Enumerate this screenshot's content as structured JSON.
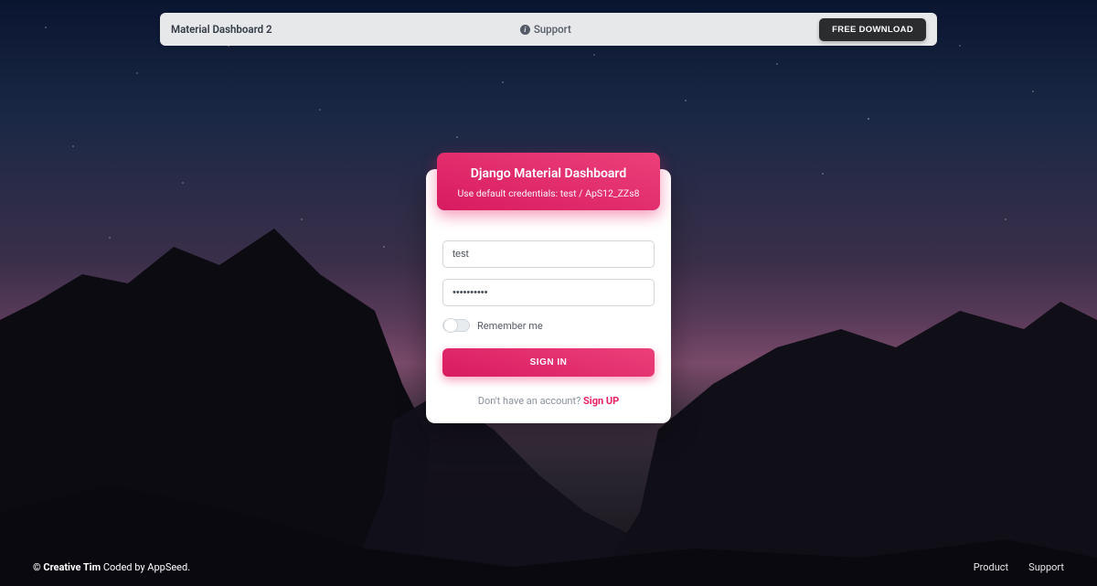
{
  "nav": {
    "brand": "Material Dashboard 2",
    "support": "Support",
    "download": "FREE DOWNLOAD"
  },
  "card": {
    "title": "Django Material Dashboard",
    "subtitle": "Use default credentials: test / ApS12_ZZs8"
  },
  "form": {
    "username_value": "test",
    "password_value": "••••••••••",
    "remember_label": "Remember me",
    "signin_label": "SIGN IN",
    "signup_prompt": "Don't have an account? ",
    "signup_link": "Sign UP"
  },
  "footer": {
    "copyright_bold": "© Creative Tim",
    "copyright_rest": " Coded by AppSeed.",
    "links": [
      "Product",
      "Support"
    ]
  },
  "colors": {
    "accent": "#e91e63",
    "navbar_bg": "#e6e8ea",
    "button_dark": "#2a2c2e"
  }
}
